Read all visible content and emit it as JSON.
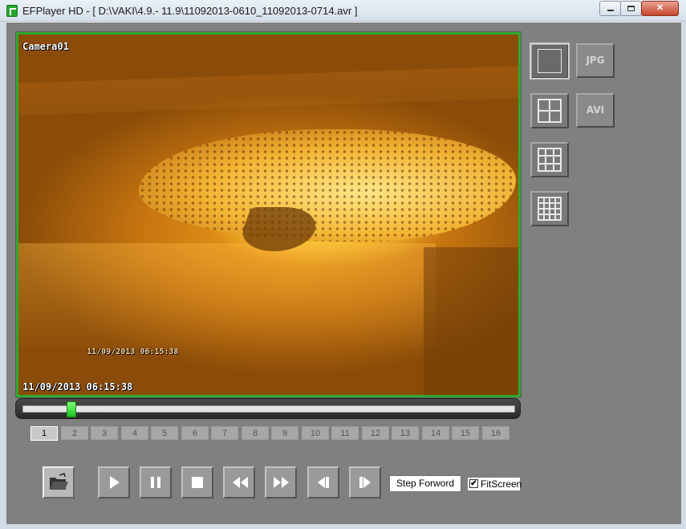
{
  "window": {
    "title": "EFPlayer HD - [ D:\\VAKI\\4.9.- 11.9\\11092013-0610_11092013-0714.avr ]",
    "close_glyph": "✕"
  },
  "video": {
    "camera_label": "Camera01",
    "timestamp": "11/09/2013  06:15:38",
    "embedded_timestamp": "11/09/2013 06:15:38"
  },
  "seek": {
    "position": 0.1
  },
  "channels": [
    "1",
    "2",
    "3",
    "4",
    "5",
    "6",
    "7",
    "8",
    "9",
    "10",
    "11",
    "12",
    "13",
    "14",
    "15",
    "16"
  ],
  "active_channel": "1",
  "side_buttons": {
    "jpg_label": "JPG",
    "avi_label": "AVI"
  },
  "controls": {
    "step_forward_label": "Step Forword",
    "fit_screen_label": "FitScreen",
    "fit_screen_checked": true,
    "check_glyph": "✔"
  },
  "colors": {
    "video_border": "#2fa82f",
    "seek_thumb": "#1dc21d",
    "background": "#808080"
  },
  "icons": [
    "app-icon",
    "folder-icon",
    "play-icon",
    "pause-icon",
    "stop-icon",
    "rewind-icon",
    "fast-forward-icon",
    "step-back-icon",
    "step-forward-icon"
  ]
}
